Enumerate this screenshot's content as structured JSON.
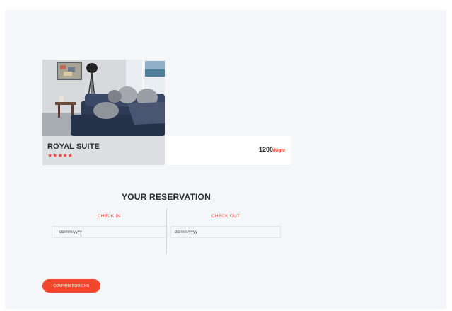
{
  "room": {
    "name": "ROYAL SUITE",
    "stars": "★★★★★",
    "price": "1200",
    "price_unit": "/Night",
    "image_icon": "room-photo"
  },
  "reservation": {
    "title": "YOUR RESERVATION",
    "check_in_label": "CHECK IN",
    "check_out_label": "CHECK OUT",
    "check_in_placeholder": "dd/mm/yyyy",
    "check_out_placeholder": "dd/mm/yyyy"
  },
  "actions": {
    "confirm_label": "CONFIRM BOOKING"
  },
  "colors": {
    "accent": "#ec4137",
    "button": "#f2472d",
    "background": "#f5f6f9"
  }
}
